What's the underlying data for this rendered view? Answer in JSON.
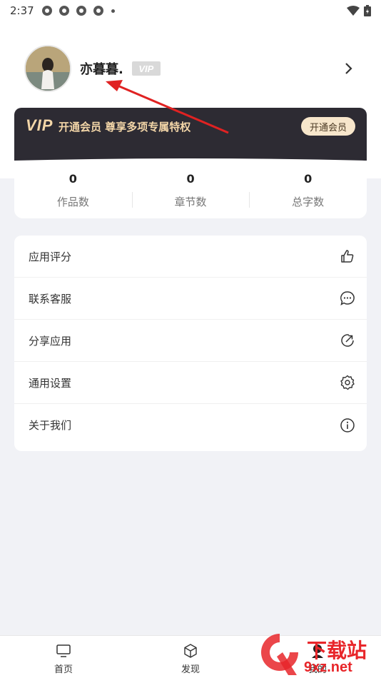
{
  "status_bar": {
    "time": "2:37"
  },
  "profile": {
    "username": "亦暮暮.",
    "vip_badge": "VIP"
  },
  "vip_banner": {
    "logo": "VIP",
    "text": "开通会员 尊享多项专属特权",
    "button": "开通会员",
    "colors": {
      "bg": "#2d2b33",
      "gold": "#f3d6a8"
    }
  },
  "stats": [
    {
      "value": "0",
      "label": "作品数"
    },
    {
      "value": "0",
      "label": "章节数"
    },
    {
      "value": "0",
      "label": "总字数"
    }
  ],
  "menu": [
    {
      "label": "应用评分",
      "icon": "thumbs-up-icon"
    },
    {
      "label": "联系客服",
      "icon": "chat-bubble-icon"
    },
    {
      "label": "分享应用",
      "icon": "share-icon"
    },
    {
      "label": "通用设置",
      "icon": "gear-icon"
    },
    {
      "label": "关于我们",
      "icon": "info-icon"
    }
  ],
  "tabs": [
    {
      "label": "首页",
      "icon": "monitor-icon"
    },
    {
      "label": "发现",
      "icon": "cube-icon"
    },
    {
      "label": "我的",
      "icon": "person-icon"
    }
  ],
  "watermark": {
    "text": "下载站",
    "sub": "9xz.net"
  }
}
